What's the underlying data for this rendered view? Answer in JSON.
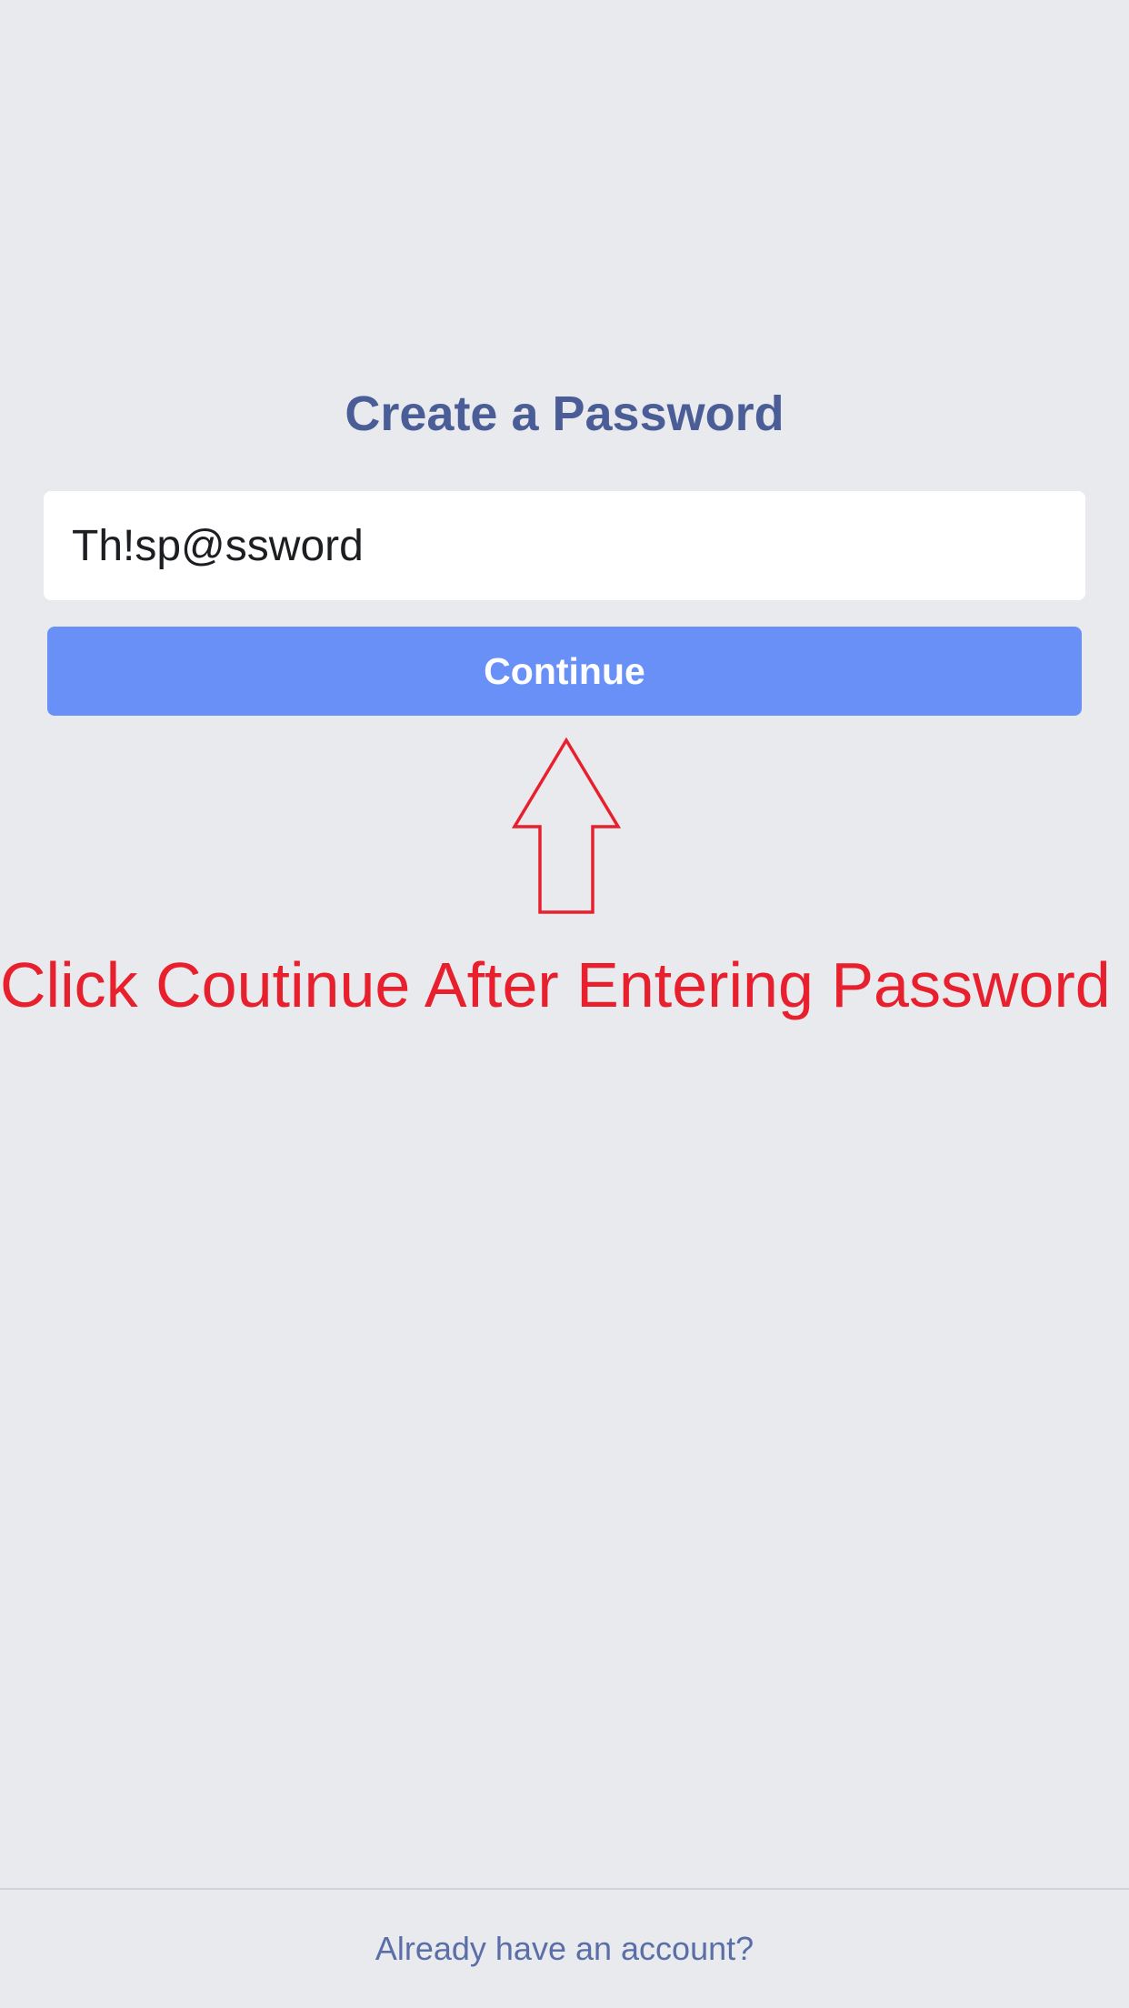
{
  "page": {
    "title": "Create a Password"
  },
  "password_field": {
    "value": "Th!sp@ssword"
  },
  "continue_button": {
    "label": "Continue"
  },
  "annotation": {
    "text": "Click Coutinue After Entering Password",
    "color": "#e8202e",
    "arrow_icon": "up-arrow-icon"
  },
  "footer": {
    "login_link": "Already have an account?"
  },
  "colors": {
    "background": "#e9eaee",
    "title": "#4a5d96",
    "button": "#6890f7",
    "link": "#5a6ea7"
  }
}
